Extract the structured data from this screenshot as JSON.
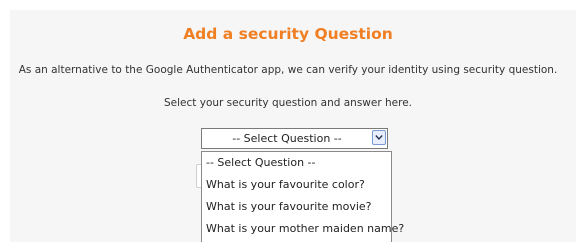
{
  "form": {
    "title": "Add a security Question",
    "description": "As an alternative to the Google Authenticator app, we can verify your identity using security question.",
    "instruction": "Select your security question and answer here."
  },
  "question_select": {
    "selected": "-- Select Question --",
    "options": [
      "-- Select Question --",
      "What is your favourite color?",
      "What is your favourite movie?",
      "What is your mother maiden name?"
    ]
  },
  "colors": {
    "title": "#f07f24",
    "panel_background": "#f6f6f6"
  },
  "icons": {
    "select_arrow": "chevron-down-icon"
  }
}
